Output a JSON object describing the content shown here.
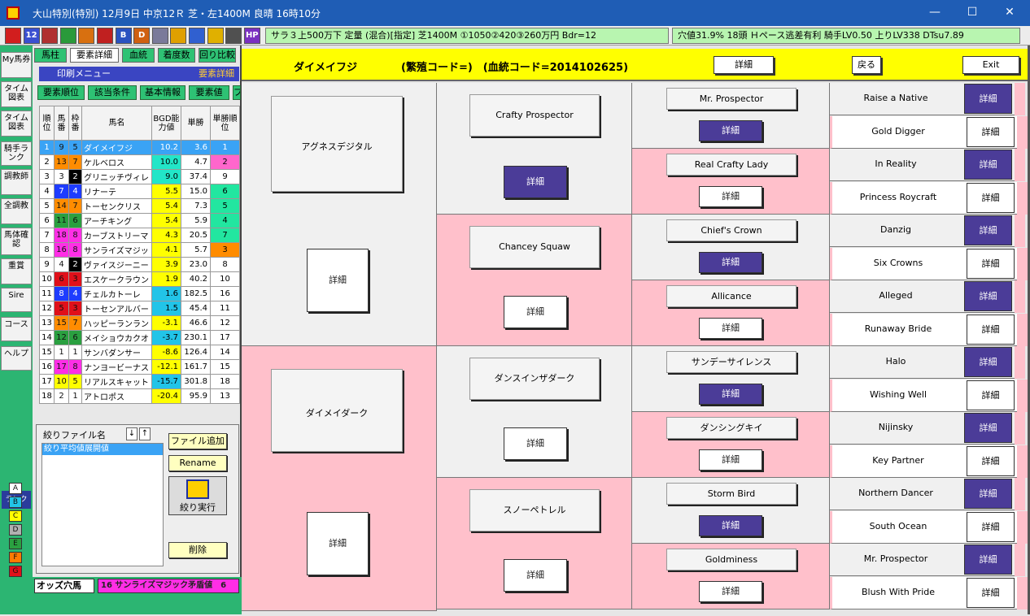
{
  "window": {
    "title": "大山特別(特別) 12月9日 中京12Ｒ 芝・左1400M 良晴 16時10分",
    "min": "—",
    "max": "☐",
    "close": "✕"
  },
  "toolbar": {
    "icons": [
      {
        "name": "app-icon",
        "text": "",
        "color": "#d21e1e"
      },
      {
        "name": "race-card-icon",
        "text": "12",
        "color": "#3a4fd0"
      },
      {
        "name": "flag-icon",
        "text": "",
        "color": "#b03030"
      },
      {
        "name": "pen-icon",
        "text": "",
        "color": "#2a9a3a"
      },
      {
        "name": "horse-icon",
        "text": "",
        "color": "#d87010"
      },
      {
        "name": "target-icon",
        "text": "",
        "color": "#c02020"
      },
      {
        "name": "b-icon",
        "text": "B",
        "color": "#2a52c0"
      },
      {
        "name": "d-icon",
        "text": "D",
        "color": "#d06010"
      },
      {
        "name": "search-icon",
        "text": "",
        "color": "#7a7a9a"
      },
      {
        "name": "gear-sun-icon",
        "text": "",
        "color": "#e0a000"
      },
      {
        "name": "wand-icon",
        "text": "",
        "color": "#3060d0"
      },
      {
        "name": "dog-icon",
        "text": "",
        "color": "#e0b000"
      },
      {
        "name": "clock-icon",
        "text": "",
        "color": "#505050"
      },
      {
        "name": "hp-icon",
        "text": "HP",
        "color": "#7a30c0"
      }
    ],
    "info_left": "サラ３上500万下 定量 (混合)[指定] 芝1400M ①1050②420③260万円 Bdr=12",
    "info_right": "穴値31.9% 18頭 Ｈペース逃差有利 騎手LV0.50 上りLV338 DTsu7.89"
  },
  "nav": {
    "items": [
      {
        "label": "My馬券",
        "active": false
      },
      {
        "label": "タイム図表",
        "active": false
      },
      {
        "label": "タイム図表",
        "active": false
      },
      {
        "label": "騎手ランク",
        "active": false
      },
      {
        "label": "調教師",
        "active": false
      },
      {
        "label": "全調教",
        "active": false
      },
      {
        "label": "馬体確認",
        "active": false
      },
      {
        "label": "重賞",
        "active": false
      },
      {
        "label": "Sire",
        "active": false
      },
      {
        "label": "コース",
        "active": false
      },
      {
        "label": "ヘルプ",
        "active": false
      }
    ],
    "rank_label": "ランク",
    "ranks": [
      {
        "label": "A",
        "color": "#ffffff",
        "text": "#111"
      },
      {
        "label": "B",
        "color": "#22c4e8",
        "text": "#111"
      },
      {
        "label": "C",
        "color": "#ffff00",
        "text": "#111"
      },
      {
        "label": "D",
        "color": "#b0b0b0",
        "text": "#111"
      },
      {
        "label": "E",
        "color": "#2aa040",
        "text": "#111"
      },
      {
        "label": "F",
        "color": "#ff7a00",
        "text": "#111"
      },
      {
        "label": "G",
        "color": "#e0101a",
        "text": "#111"
      }
    ]
  },
  "list": {
    "tabs": [
      {
        "label": "馬柱",
        "color": "#2ec274"
      },
      {
        "label": "要素詳細",
        "color": "#ffffff"
      },
      {
        "label": "血統",
        "color": "#2ec274"
      },
      {
        "label": "着度数",
        "color": "#2ec274"
      },
      {
        "label": "回り比較",
        "color": "#2ec274"
      }
    ],
    "print_menu": "印刷メニュー",
    "print_title": "要素詳細",
    "filter_tabs": [
      "要素順位",
      "該当条件",
      "基本情報",
      "要素値",
      "プ"
    ],
    "headers": [
      "順位",
      "馬番",
      "枠番",
      "馬名",
      "BGD能力値",
      "単勝",
      "単勝順位"
    ],
    "rows": [
      {
        "rank": "1",
        "num": "9",
        "waku": "5",
        "name": "ダイメイフジ",
        "bgd": "10.2",
        "odds": "3.6",
        "orank": "1",
        "wc": "#ffcc00",
        "wt": "#111",
        "nc": "#3aa3f5",
        "bc": "#3aa3f5",
        "oc": "#3aa3f5",
        "sel": true
      },
      {
        "rank": "2",
        "num": "13",
        "waku": "7",
        "name": "ケルベロス",
        "bgd": "10.0",
        "odds": "4.7",
        "orank": "2",
        "wc": "#ff8c00",
        "wt": "#111",
        "nc": "#ff8c00",
        "bc": "#22e6c8",
        "oc": "#ff66cc",
        "sel": false
      },
      {
        "rank": "3",
        "num": "3",
        "waku": "2",
        "name": "グリニッチヴィレ",
        "bgd": "9.0",
        "odds": "37.4",
        "orank": "9",
        "wc": "#000000",
        "wt": "#fff",
        "nc": "#ffffff",
        "bc": "#22e6c8",
        "oc": "#ffffff",
        "sel": false
      },
      {
        "rank": "4",
        "num": "7",
        "waku": "4",
        "name": "リナーテ",
        "bgd": "5.5",
        "odds": "15.0",
        "orank": "6",
        "wc": "#1e3cff",
        "wt": "#fff",
        "nc": "#1e3cff",
        "bc": "#ffff00",
        "oc": "#22e6a0",
        "sel": false
      },
      {
        "rank": "5",
        "num": "14",
        "waku": "7",
        "name": "トーセンクリス",
        "bgd": "5.4",
        "odds": "7.3",
        "orank": "5",
        "wc": "#ff8c00",
        "wt": "#111",
        "nc": "#ff8c00",
        "bc": "#ffff00",
        "oc": "#22e6a0",
        "sel": false
      },
      {
        "rank": "6",
        "num": "11",
        "waku": "6",
        "name": "アーチキング",
        "bgd": "5.4",
        "odds": "5.9",
        "orank": "4",
        "wc": "#2aa040",
        "wt": "#111",
        "nc": "#2aa040",
        "bc": "#ffff00",
        "oc": "#22e6a0",
        "sel": false
      },
      {
        "rank": "7",
        "num": "18",
        "waku": "8",
        "name": "カーブストリーマ",
        "bgd": "4.3",
        "odds": "20.5",
        "orank": "7",
        "wc": "#ff2ee6",
        "wt": "#111",
        "nc": "#ff2ee6",
        "bc": "#ffff00",
        "oc": "#22e6a0",
        "sel": false
      },
      {
        "rank": "8",
        "num": "16",
        "waku": "8",
        "name": "サンライズマジッ",
        "bgd": "4.1",
        "odds": "5.7",
        "orank": "3",
        "wc": "#ff2ee6",
        "wt": "#111",
        "nc": "#ff2ee6",
        "bc": "#ffff00",
        "oc": "#ff8c00",
        "sel": false
      },
      {
        "rank": "9",
        "num": "4",
        "waku": "2",
        "name": "ヴァイスジーニー",
        "bgd": "3.9",
        "odds": "23.0",
        "orank": "8",
        "wc": "#000000",
        "wt": "#fff",
        "nc": "#ffffff",
        "bc": "#ffff00",
        "oc": "#ffffff",
        "sel": false
      },
      {
        "rank": "10",
        "num": "6",
        "waku": "3",
        "name": "エスケークラウン",
        "bgd": "1.9",
        "odds": "40.2",
        "orank": "10",
        "wc": "#e0101a",
        "wt": "#111",
        "nc": "#e0101a",
        "bc": "#ffff00",
        "oc": "#ffffff",
        "sel": false
      },
      {
        "rank": "11",
        "num": "8",
        "waku": "4",
        "name": "チェルカトーレ",
        "bgd": "1.6",
        "odds": "182.5",
        "orank": "16",
        "wc": "#1e3cff",
        "wt": "#fff",
        "nc": "#1e3cff",
        "bc": "#22c4e8",
        "oc": "#ffffff",
        "sel": false
      },
      {
        "rank": "12",
        "num": "5",
        "waku": "3",
        "name": "トーセンアルバー",
        "bgd": "1.5",
        "odds": "45.4",
        "orank": "11",
        "wc": "#e0101a",
        "wt": "#111",
        "nc": "#e0101a",
        "bc": "#22c4e8",
        "oc": "#ffffff",
        "sel": false
      },
      {
        "rank": "13",
        "num": "15",
        "waku": "7",
        "name": "ハッピーランラン",
        "bgd": "-3.1",
        "odds": "46.6",
        "orank": "12",
        "wc": "#ff8c00",
        "wt": "#111",
        "nc": "#ff8c00",
        "bc": "#ffff00",
        "oc": "#ffffff",
        "sel": false
      },
      {
        "rank": "14",
        "num": "12",
        "waku": "6",
        "name": "メイショウカクオ",
        "bgd": "-3.7",
        "odds": "230.1",
        "orank": "17",
        "wc": "#2aa040",
        "wt": "#111",
        "nc": "#2aa040",
        "bc": "#22c4e8",
        "oc": "#ffffff",
        "sel": false
      },
      {
        "rank": "15",
        "num": "1",
        "waku": "1",
        "name": "サンバダンサー",
        "bgd": "-8.6",
        "odds": "126.4",
        "orank": "14",
        "wc": "#ffffff",
        "wt": "#111",
        "nc": "#ffffff",
        "bc": "#ffff00",
        "oc": "#ffffff",
        "sel": false
      },
      {
        "rank": "16",
        "num": "17",
        "waku": "8",
        "name": "ナンヨービーナス",
        "bgd": "-12.1",
        "odds": "161.7",
        "orank": "15",
        "wc": "#ff2ee6",
        "wt": "#111",
        "nc": "#ff2ee6",
        "bc": "#ffff00",
        "oc": "#ffffff",
        "sel": false
      },
      {
        "rank": "17",
        "num": "10",
        "waku": "5",
        "name": "リアルスキャット",
        "bgd": "-15.7",
        "odds": "301.8",
        "orank": "18",
        "wc": "#ffff00",
        "wt": "#111",
        "nc": "#ffff00",
        "bc": "#22c4e8",
        "oc": "#ffffff",
        "sel": false
      },
      {
        "rank": "18",
        "num": "2",
        "waku": "1",
        "name": "アトロポス",
        "bgd": "-20.4",
        "odds": "95.9",
        "orank": "13",
        "wc": "#ffffff",
        "wt": "#111",
        "nc": "#ffffff",
        "bc": "#ffff00",
        "oc": "#ffffff",
        "sel": false
      }
    ],
    "file_header": "絞りファイル名",
    "sort_down": "↓",
    "sort_up": "↑",
    "file_item": "絞り平均値展開値",
    "btn_add": "ファイル追加",
    "btn_rename": "Rename",
    "btn_run": "絞り実行",
    "btn_delete": "削除",
    "odds_label": "オッズ穴馬",
    "odds_value": "16 サンライズマジック矛盾値　6"
  },
  "header": {
    "horse": "ダイメイフジ",
    "codes": "(繁殖コード=)　(血統コード=2014102625)",
    "detail": "詳細",
    "back": "戻る",
    "exit": "Exit"
  },
  "pedigree": {
    "detail": "詳細",
    "gen1": [
      "アグネスデジタル",
      "ダイメイダーク"
    ],
    "gen2": [
      "Crafty Prospector",
      "Chancey Squaw",
      "ダンスインザダーク",
      "スノーペトレル"
    ],
    "gen3": [
      "Mr. Prospector",
      "Real Crafty Lady",
      "Chief's Crown",
      "Allicance",
      "サンデーサイレンス",
      "ダンシングキイ",
      "Storm Bird",
      "Goldminess"
    ],
    "gen4": [
      "Raise a Native",
      "Gold Digger",
      "In Reality",
      "Princess Roycraft",
      "Danzig",
      "Six Crowns",
      "Alleged",
      "Runaway Bride",
      "Halo",
      "Wishing Well",
      "Nijinsky",
      "Key Partner",
      "Northern Dancer",
      "South Ocean",
      "Mr. Prospector",
      "Blush With Pride"
    ]
  }
}
